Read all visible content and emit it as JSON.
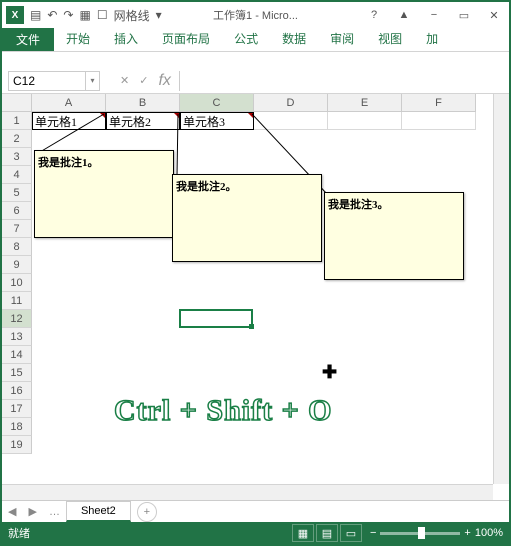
{
  "title": "工作簿1 - Micro...",
  "qat": {
    "gridlines_label": "网格线"
  },
  "tabs": {
    "file": "文件",
    "home": "开始",
    "insert": "插入",
    "layout": "页面布局",
    "formulas": "公式",
    "data": "数据",
    "review": "审阅",
    "view": "视图",
    "add": "加"
  },
  "name_box": "C12",
  "columns": [
    "A",
    "B",
    "C",
    "D",
    "E",
    "F"
  ],
  "rows": [
    "1",
    "2",
    "3",
    "4",
    "5",
    "6",
    "7",
    "8",
    "9",
    "10",
    "11",
    "12",
    "13",
    "14",
    "15",
    "16",
    "17",
    "18",
    "19"
  ],
  "cells": {
    "A1": "单元格1",
    "B1": "单元格2",
    "C1": "单元格3"
  },
  "comments": {
    "c1": "我是批注1。",
    "c2": "我是批注2。",
    "c3": "我是批注3。"
  },
  "shortcut": "Ctrl + Shift + O",
  "sheet": {
    "active": "Sheet2",
    "new": "+",
    "nav": "…"
  },
  "status": {
    "ready": "就绪",
    "zoom": "100%",
    "plus": "+",
    "minus": "−"
  },
  "icons": {
    "min": "−",
    "max": "▭",
    "close": "✕",
    "help": "?",
    "fx": "fx",
    "check": "✓",
    "x": "✕",
    "chev": "▾",
    "undo": "↶",
    "redo": "↷",
    "save": "💾",
    "up": "▲"
  }
}
